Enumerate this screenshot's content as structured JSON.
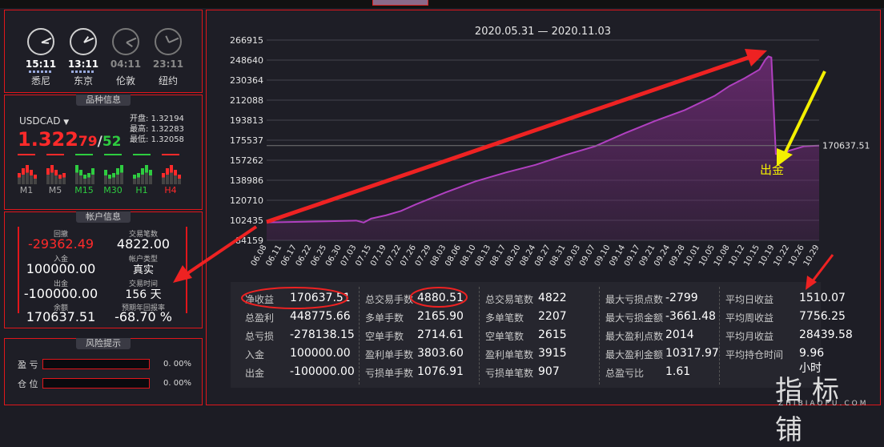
{
  "colors": {
    "accent": "#e0161b",
    "chart_line": "#b040c0",
    "chart_fill": "#6a2a70",
    "up": "#2ecc40",
    "down": "#ff2a2a"
  },
  "clocks": [
    {
      "time": "15:11",
      "city": "悉尼",
      "dim": false
    },
    {
      "time": "13:11",
      "city": "东京",
      "dim": false
    },
    {
      "time": "04:11",
      "city": "伦敦",
      "dim": true
    },
    {
      "time": "23:11",
      "city": "纽约",
      "dim": true
    }
  ],
  "symbol_panel": {
    "title": "品种信息",
    "symbol": "USDCAD",
    "price_main": "1.322",
    "price_bid": "79",
    "price_sep": "/",
    "price_ask": "52",
    "open_label": "开盘:",
    "open_value": "1.32194",
    "high_label": "最高:",
    "high_value": "1.32283",
    "low_label": "最低:",
    "low_value": "1.32058",
    "timeframes": [
      "M1",
      "M5",
      "M15",
      "M30",
      "H1",
      "H4"
    ]
  },
  "account_panel": {
    "title": "帐户信息",
    "drawdown_label": "回撤",
    "drawdown_value": "-29362.49",
    "trades_label": "交易笔数",
    "trades_value": "4822.00",
    "deposit_label": "入金",
    "deposit_value": "100000.00",
    "acct_type_label": "帐户类型",
    "acct_type_value": "真实",
    "withdraw_label": "出金",
    "withdraw_value": "-100000.00",
    "days_label": "交易时间",
    "days_value": "156 天",
    "balance_label": "余额",
    "balance_value": "170637.51",
    "annual_label": "预期年回报率",
    "annual_value": "-68.70 %"
  },
  "risk_panel": {
    "title": "风险提示",
    "rows": [
      {
        "label": "盈 亏",
        "pct": "0. 00%"
      },
      {
        "label": "仓 位",
        "pct": "0. 00%"
      }
    ]
  },
  "chart_data": {
    "type": "area",
    "title": "2020.05.31 — 2020.11.03",
    "y_ticks": [
      "266915",
      "248640",
      "230364",
      "212088",
      "193813",
      "175537",
      "157262",
      "138986",
      "120710",
      "102435",
      "84159"
    ],
    "ylim": [
      84159,
      266915
    ],
    "x_ticks": [
      "06.08",
      "06.11",
      "06.17",
      "06.22",
      "06.25",
      "06.30",
      "07.03",
      "07.15",
      "07.19",
      "07.22",
      "07.26",
      "07.29",
      "08.03",
      "08.06",
      "08.10",
      "08.13",
      "08.17",
      "08.20",
      "08.24",
      "08.27",
      "08.31",
      "09.03",
      "09.07",
      "09.10",
      "09.14",
      "09.17",
      "09.21",
      "09.24",
      "09.28",
      "10.01",
      "10.05",
      "10.08",
      "10.12",
      "10.15",
      "10.19",
      "10.22",
      "10.26",
      "10.29"
    ],
    "last_value_label": "170637.51",
    "annotation": "出金",
    "points": [
      [
        0,
        100500
      ],
      [
        4,
        101500
      ],
      [
        6,
        102200
      ],
      [
        6.5,
        100400
      ],
      [
        7,
        104000
      ],
      [
        8,
        107000
      ],
      [
        9,
        111000
      ],
      [
        10,
        117000
      ],
      [
        12,
        128000
      ],
      [
        14,
        138000
      ],
      [
        16,
        146000
      ],
      [
        18,
        153000
      ],
      [
        20,
        162000
      ],
      [
        22,
        170000
      ],
      [
        24,
        182000
      ],
      [
        26,
        193000
      ],
      [
        28,
        203000
      ],
      [
        30,
        216000
      ],
      [
        31,
        225000
      ],
      [
        32,
        232000
      ],
      [
        33,
        240000
      ],
      [
        33.4,
        249000
      ],
      [
        33.6,
        252000
      ],
      [
        33.8,
        251000
      ],
      [
        34.1,
        163000
      ],
      [
        34.5,
        162000
      ],
      [
        35,
        166000
      ],
      [
        36,
        170000
      ],
      [
        37,
        170637.51
      ]
    ]
  },
  "stats": {
    "col1": [
      {
        "label": "净收益",
        "value": "170637.51"
      },
      {
        "label": "总盈利",
        "value": "448775.66"
      },
      {
        "label": "总亏损",
        "value": "-278138.15"
      },
      {
        "label": "入金",
        "value": "100000.00"
      },
      {
        "label": "出金",
        "value": "-100000.00"
      }
    ],
    "col2": [
      {
        "label": "总交易手数",
        "value": "4880.51"
      },
      {
        "label": "多单手数",
        "value": "2165.90"
      },
      {
        "label": "空单手数",
        "value": "2714.61"
      },
      {
        "label": "盈利单手数",
        "value": "3803.60"
      },
      {
        "label": "亏损单手数",
        "value": "1076.91"
      }
    ],
    "col3": [
      {
        "label": "总交易笔数",
        "value": "4822"
      },
      {
        "label": "多单笔数",
        "value": "2207"
      },
      {
        "label": "空单笔数",
        "value": "2615"
      },
      {
        "label": "盈利单笔数",
        "value": "3915"
      },
      {
        "label": "亏损单笔数",
        "value": "907"
      }
    ],
    "col4": [
      {
        "label": "最大亏损点数",
        "value": "-2799"
      },
      {
        "label": "最大亏损金额",
        "value": "-3661.48"
      },
      {
        "label": "最大盈利点数",
        "value": "2014"
      },
      {
        "label": "最大盈利金额",
        "value": "10317.97"
      },
      {
        "label": "总盈亏比",
        "value": "1.61"
      }
    ],
    "col5": [
      {
        "label": "平均日收益",
        "value": "1510.07"
      },
      {
        "label": "平均周收益",
        "value": "7756.25"
      },
      {
        "label": "平均月收益",
        "value": "28439.58"
      },
      {
        "label": "平均持仓时间",
        "value": "9.96小时"
      }
    ]
  },
  "watermark": {
    "text": "指标铺",
    "sub": "ZHIBIAOPU.COM"
  }
}
